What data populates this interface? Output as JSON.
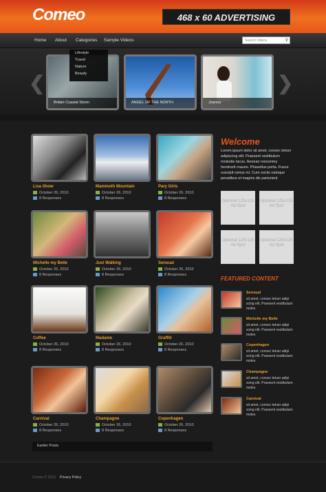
{
  "header": {
    "logo": "Comeo",
    "ad_banner": "468 x 60 ADVERTISING",
    "accent": "#e8561a"
  },
  "nav": {
    "items": [
      "Home",
      "About",
      "Categories",
      "Sample Videos"
    ],
    "search_placeholder": "Search Videos",
    "dropdown": [
      "Lifestyle",
      "Travel",
      "Nature",
      "Beauty"
    ]
  },
  "slider": {
    "slides": [
      {
        "caption": "Britain Coastal Storm"
      },
      {
        "caption": "ANGEL OF THE NORTH"
      },
      {
        "caption": "Joanna"
      }
    ]
  },
  "posts": [
    {
      "title": "Lisa Show",
      "date": "October 26, 2010",
      "responses": "8 Responses"
    },
    {
      "title": "Mammoth Mountain",
      "date": "October 26, 2010",
      "responses": "8 Responses"
    },
    {
      "title": "Pary Girls",
      "date": "October 26, 2010",
      "responses": "8 Responses"
    },
    {
      "title": "Michelle my Belle",
      "date": "October 26, 2010",
      "responses": "8 Responses"
    },
    {
      "title": "Just Walking",
      "date": "October 26, 2010",
      "responses": "8 Responses"
    },
    {
      "title": "Sensual",
      "date": "October 26, 2010",
      "responses": "8 Responses"
    },
    {
      "title": "Coffee",
      "date": "October 26, 2010",
      "responses": "8 Responses"
    },
    {
      "title": "Madame",
      "date": "October 26, 2010",
      "responses": "8 Responses"
    },
    {
      "title": "Graffiti",
      "date": "October 26, 2010",
      "responses": "8 Responses"
    },
    {
      "title": "Carnival",
      "date": "October 26, 2010",
      "responses": "8 Responses"
    },
    {
      "title": "Champagne",
      "date": "October 26, 2010",
      "responses": "8 Responses"
    },
    {
      "title": "Copenhagen",
      "date": "October 26, 2010",
      "responses": "8 Responses"
    }
  ],
  "sidebar": {
    "welcome_title": "Welcome",
    "welcome_text": "Lorem ipsum dolor sit amet, consec tetuer adipiscing elit. Praesent vestibulum molestie lacus. Aenean nonummy hendrerit mauris. Phasellus porta. Fusce suscipit varius mi. Cum sociis natoque penatibus et magnis dis parturient",
    "ad_spot": "Optional 125x125 Ad Spot",
    "featured_title": "FEATURED CONTENT",
    "featured": [
      {
        "title": "Sensual",
        "text": "sit amet, consec tetuer adipi scing elit. Praesent vestibulum moles"
      },
      {
        "title": "Michelle my Belle",
        "text": "sit amet, consec tetuer adipi scing elit. Praesent vestibulum moles"
      },
      {
        "title": "Copenhagen",
        "text": "sit amet, consec tetuer adipi scing elit. Praesent vestibulum moles"
      },
      {
        "title": "Champagne",
        "text": "sit amet, consec tetuer adipi scing elit. Praesent vestibulum moles"
      },
      {
        "title": "Carnival",
        "text": "sit amet, consec tetuer adipi scing elit. Praesent vestibulum moles"
      }
    ]
  },
  "earlier_posts": "Earlier Posts",
  "footer": {
    "copyright": "Comeo © 2010",
    "privacy": "Privacy Policy"
  }
}
